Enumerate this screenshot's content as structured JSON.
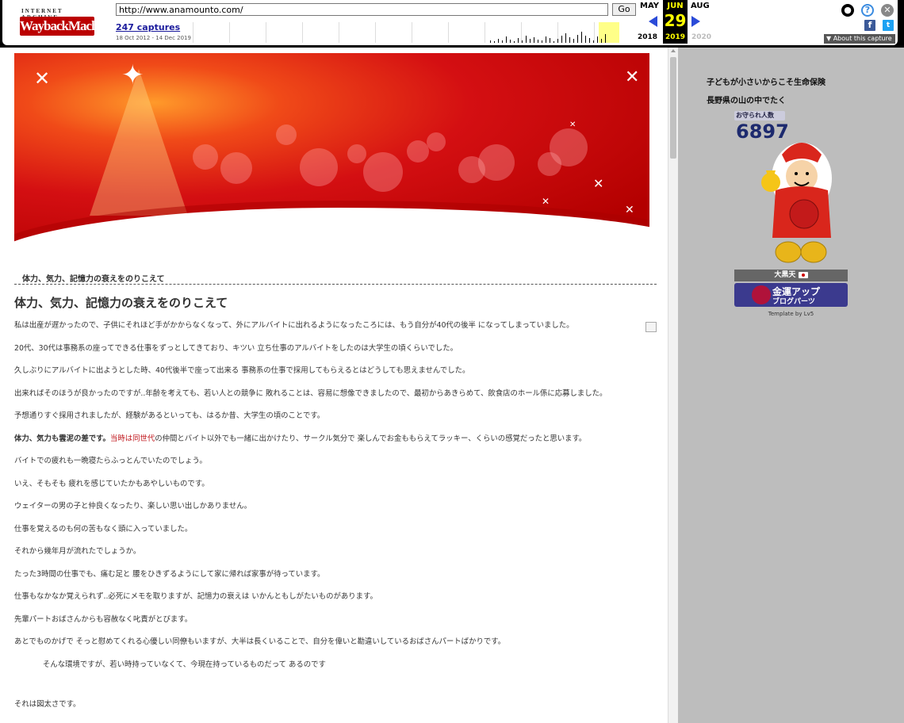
{
  "wayback": {
    "url": "http://www.anamounto.com/",
    "go_label": "Go",
    "captures_label": "247 captures",
    "date_range": "18 Oct 2012 - 14 Dec 2019",
    "logo_top": "INTERNET ARCHIVE",
    "logo_main": "WaybackMachine",
    "prev_month": "MAY",
    "cur_month": "JUN",
    "next_month": "AUG",
    "day": "29",
    "prev_year": "2018",
    "cur_year": "2019",
    "next_year": "2020",
    "about_label": "▼ About this capture",
    "accent": "#ffff00"
  },
  "sidebar": {
    "line1": "子どもが小さいからこそ生命保険",
    "line2": "長野県の山の中でたく",
    "widget": {
      "count_label": "お守られ人数",
      "count": "6897",
      "bar_label": "大黒天",
      "button_line1": "金運アップ",
      "button_line2": "ブログパーツ",
      "template_credit": "Template by Lv5"
    }
  },
  "article": {
    "breadcrumb": "体力、気力、記憶力の衰えをのりこえて",
    "title": "体力、気力、記憶力の衰えをのりこえて",
    "p1": "私は出産が遅かったので、子供にそれほど手がかからなくなって、外にアルバイトに出れるようになったころには、もう自分が40代の後半 になってしまっていました。",
    "p2": "20代、30代は事務系の座ってできる仕事をずっとしてきており、キツい 立ち仕事のアルバイトをしたのは大学生の頃くらいでした。",
    "p3": "久しぶりにアルバイトに出ようとした時、40代後半で座って出来る 事務系の仕事で採用してもらえるとはどうしても思えませんでした。",
    "p4": "出来ればそのほうが良かったのですが..年齢を考えても、若い人との競争に 敗れることは、容易に想像できましたので、最初からあきらめて、飲食店のホール係に応募しました。",
    "p5": "予想通りすぐ採用されましたが、経験があるといっても、はるか昔、大学生の頃のことです。",
    "p6_bold": "体力、気力も雲泥の差です。",
    "p6_red": "当時は同世代",
    "p6_rest": "の仲間とバイト以外でも一緒に出かけたり、サークル気分で 楽しんでお金ももらえてラッキー、くらいの感覚だったと思います。",
    "p7": "バイトでの疲れも一晩寝たらふっとんでいたのでしょう。",
    "p8": "いえ、そもそも 疲れを感じていたかもあやしいものです。",
    "p9": "ウェイターの男の子と仲良くなったり、楽しい思い出しかありません。",
    "p10": "仕事を覚えるのも何の苦もなく頭に入っていました。",
    "p11": "それから幾年月が流れたでしょうか。",
    "p12": "たった3時間の仕事でも、痛む足と 腰をひきずるようにして家に帰れば家事が待っています。",
    "p13": "仕事もなかなか覚えられず..必死にメモを取りますが、記憶力の衰えは いかんともしがたいものがあります。",
    "p14": "先輩パートおばさんからも容赦なく叱責がとびます。",
    "p15": "あとでものかげで そっと慰めてくれる心優しい同僚もいますが、大半は長くいることで、自分を偉いと勘違いしているおばさんパートばかりです。",
    "p16": "そんな環境ですが、若い時持っていなくて、今現在持っているものだって あるのです",
    "p17": "それは図太さです。"
  }
}
